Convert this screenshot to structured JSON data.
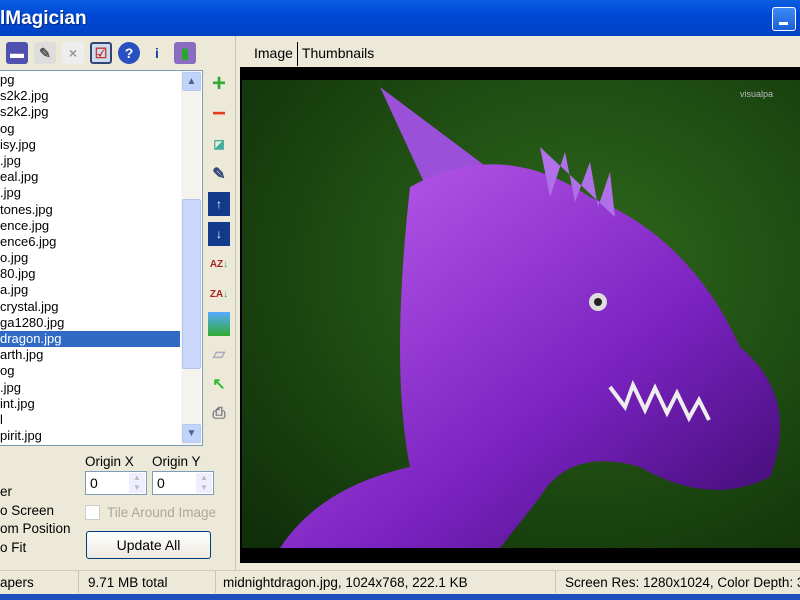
{
  "window": {
    "title": "lMagician"
  },
  "toolbar": {
    "icons": [
      "save-icon",
      "edit-icon",
      "delete-file-icon",
      "checklist-icon",
      "help-icon",
      "info-icon",
      "exit-icon"
    ]
  },
  "file_list": {
    "items": [
      "pg",
      "s2k2.jpg",
      "s2k2.jpg",
      "og",
      "isy.jpg",
      ".jpg",
      "eal.jpg",
      ".jpg",
      "tones.jpg",
      "ence.jpg",
      "ence6.jpg",
      "o.jpg",
      "80.jpg",
      "a.jpg",
      "crystal.jpg",
      "ga1280.jpg",
      "dragon.jpg",
      "arth.jpg",
      "og",
      ".jpg",
      "int.jpg",
      "l",
      "pirit.jpg"
    ],
    "selected_index": 16
  },
  "side_icons": [
    "add-icon",
    "remove-icon",
    "rename-icon",
    "edit-icon",
    "move-up-icon",
    "move-down-icon",
    "sort-az-icon",
    "sort-za-icon",
    "set-wallpaper-icon",
    "eraser-icon",
    "back-arrow-icon",
    "print-icon"
  ],
  "options": {
    "positions": [
      "er",
      "o Screen",
      "om Position",
      "o Fit"
    ],
    "origin_x_label": "Origin X",
    "origin_y_label": "Origin Y",
    "origin_x": "0",
    "origin_y": "0",
    "tile_label": "Tile Around Image",
    "tile_checked": false,
    "update_label": "Update All"
  },
  "tabs": [
    {
      "label": "Image",
      "active": true
    },
    {
      "label": "Thumbnails",
      "active": false
    }
  ],
  "viewer": {
    "watermark": "visualpa"
  },
  "status": {
    "count": "apers",
    "total": "9.71 MB total",
    "file": "midnightdragon.jpg, 1024x768, 222.1 KB",
    "screen": "Screen Res: 1280x1024, Color Depth: 3"
  },
  "colors": {
    "title_bar": "#0049d6",
    "selection": "#316ac5",
    "image_bg": "#1d4a14",
    "dragon": "#8a2ed0"
  }
}
